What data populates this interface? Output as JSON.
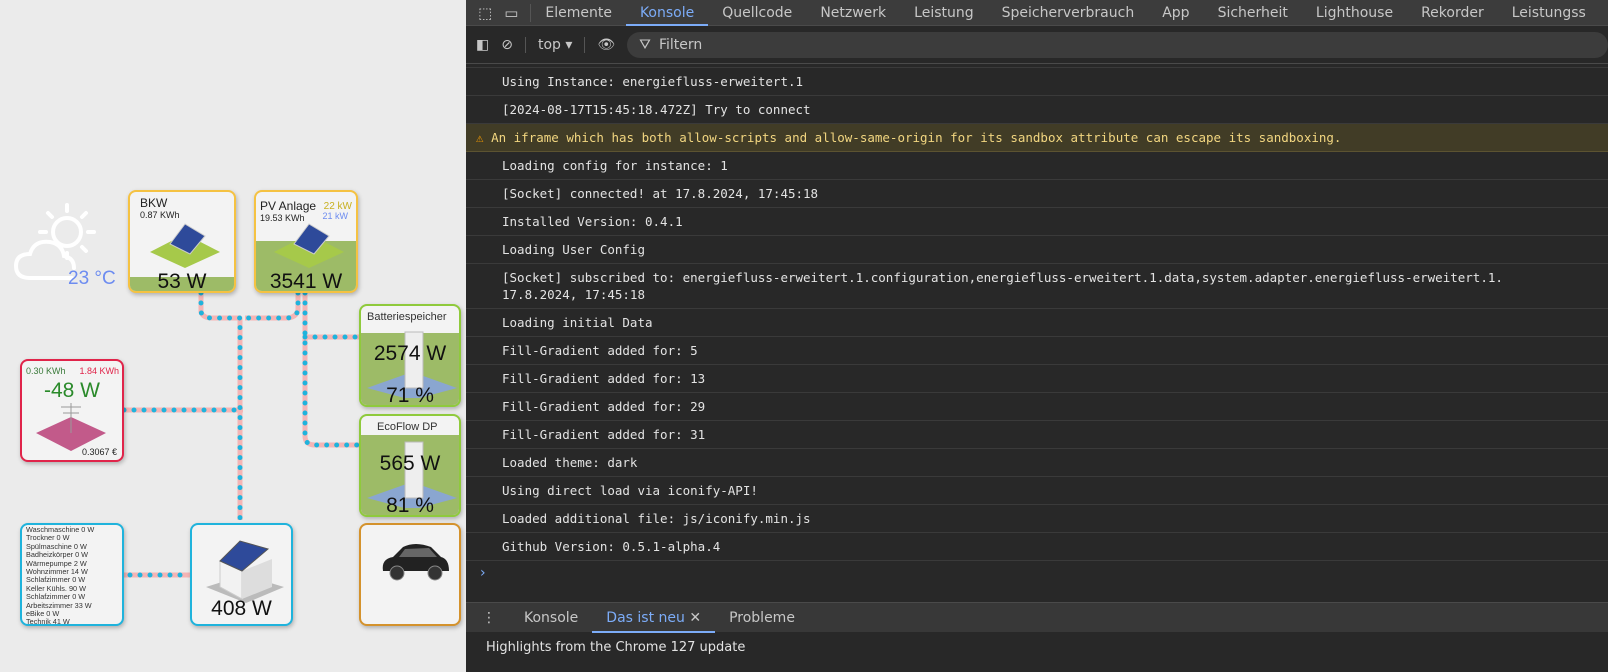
{
  "weather": {
    "icon": "sun-cloud-icon",
    "temperature": "23 °C"
  },
  "nodes": {
    "bkw": {
      "title": "BKW",
      "energy": "0.87 KWh",
      "power": "53 W"
    },
    "pv": {
      "title": "PV Anlage",
      "energy": "19.53 KWh",
      "peak1": "22 kW",
      "peak2": "21 kW",
      "power": "3541 W"
    },
    "battery": {
      "title": "Batteriespeicher",
      "power": "2574 W",
      "soc": "71 %"
    },
    "ecoflow": {
      "title": "EcoFlow DP",
      "power": "565 W",
      "soc": "81 %"
    },
    "grid": {
      "consumed": "0.30 KWh",
      "fed": "1.84 KWh",
      "power": "-48 W",
      "price": "0.3067 €"
    },
    "house": {
      "power": "408 W"
    },
    "car": {
      "icon": "car-icon"
    },
    "consumers": [
      "Waschmaschine 0 W",
      "Trockner 0 W",
      "Spülmaschine 0 W",
      "Badheizkörper 0 W",
      "Wärmepumpe 2 W",
      "Wohnzimmer 14 W",
      "Schlafzimmer 0 W",
      "Keller Kühls. 90 W",
      "Schlafzimmer 0 W",
      "Arbeitszimmer 33 W",
      "eBike 0 W",
      "Technik 41 W"
    ]
  },
  "colors": {
    "solar": "#f5c242",
    "battery": "#8fca3c",
    "grid": "#e0244a",
    "house": "#1fb3dc",
    "car": "#d4922c",
    "flow_dot": "#1fb3dc",
    "flow_line": "#f4b5b5",
    "accent": "#7cacf8"
  },
  "devtools": {
    "tabs": [
      "Elemente",
      "Konsole",
      "Quellcode",
      "Netzwerk",
      "Leistung",
      "Speicherverbrauch",
      "App",
      "Sicherheit",
      "Lighthouse",
      "Rekorder",
      "Leistungss"
    ],
    "active_tab": "Konsole",
    "context": "top ▾",
    "filter_placeholder": "Filtern",
    "logs": [
      {
        "text": "Using Instance: energiefluss-erweitert.1"
      },
      {
        "text": "[2024-08-17T15:45:18.472Z] Try to connect"
      },
      {
        "text": "An iframe which has both allow-scripts and allow-same-origin for its sandbox attribute can escape its sandboxing.",
        "level": "warning"
      },
      {
        "text": "Loading config for instance: 1"
      },
      {
        "text": "[Socket] connected! at 17.8.2024, 17:45:18"
      },
      {
        "text": "Installed Version: 0.4.1"
      },
      {
        "text": "Loading User Config"
      },
      {
        "text": "[Socket] subscribed to: energiefluss-erweitert.1.configuration,energiefluss-erweitert.1.data,system.adapter.energiefluss-erweitert.1.\n17.8.2024, 17:45:18"
      },
      {
        "text": "Loading initial Data"
      },
      {
        "text": "Fill-Gradient added for: 5"
      },
      {
        "text": "Fill-Gradient added for: 13"
      },
      {
        "text": "Fill-Gradient added for: 29"
      },
      {
        "text": "Fill-Gradient added for: 31"
      },
      {
        "text": "Loaded theme: dark"
      },
      {
        "text": "Using direct load via iconify-API!"
      },
      {
        "text": "Loaded additional file: js/iconify.min.js"
      },
      {
        "text": "Github Version: 0.5.1-alpha.4"
      }
    ],
    "prompt": "›",
    "drawer_tabs": [
      "Konsole",
      "Das ist neu",
      "Probleme"
    ],
    "drawer_active": "Das ist neu",
    "drawer_content": "Highlights from the Chrome 127 update"
  }
}
